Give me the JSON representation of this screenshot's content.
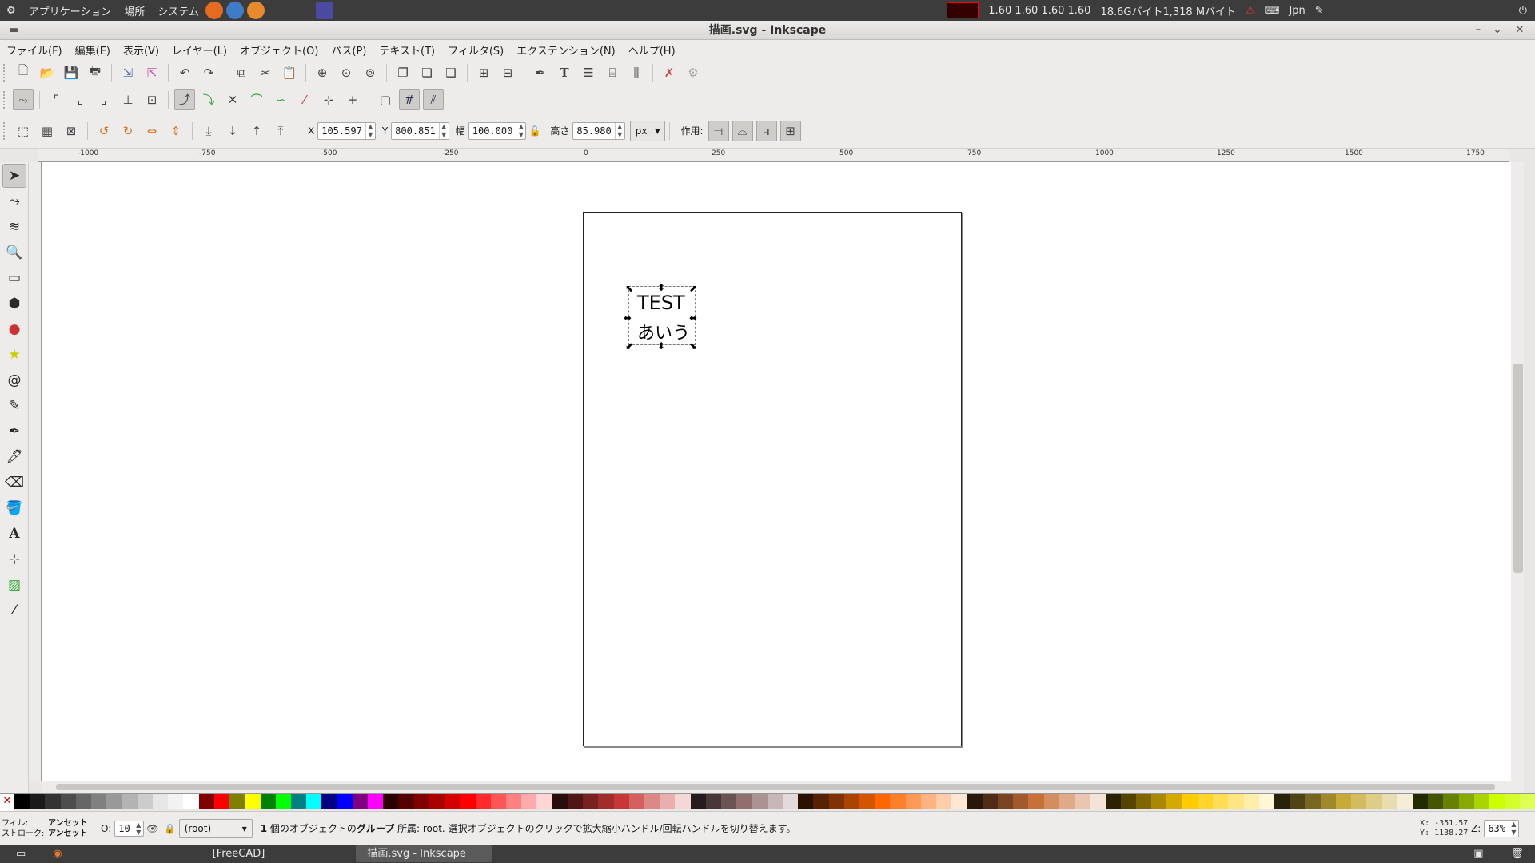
{
  "topbar": {
    "menus": [
      "アプリケーション",
      "場所",
      "システム"
    ],
    "cpu": "1.60 1.60  1.60  1.60",
    "memory": "18.6Gバイト1,318 Mバイト",
    "lang": "Jpn"
  },
  "window": {
    "title": "描画.svg - Inkscape"
  },
  "menubar": {
    "items": [
      "ファイル(F)",
      "編集(E)",
      "表示(V)",
      "レイヤー(L)",
      "オブジェクト(O)",
      "パス(P)",
      "テキスト(T)",
      "フィルタ(S)",
      "エクステンション(N)",
      "ヘルプ(H)"
    ]
  },
  "controls": {
    "x_label": "X",
    "x_value": "105.597",
    "y_label": "Y",
    "y_value": "800.851",
    "w_label": "幅",
    "w_value": "100.000",
    "h_label": "高さ",
    "h_value": "85.980",
    "unit": "px",
    "affect_label": "作用:"
  },
  "ruler": {
    "labels": [
      "-1000",
      "-750",
      "-500",
      "-250",
      "0",
      "250",
      "500",
      "750",
      "1000",
      "1250",
      "1500",
      "1750"
    ]
  },
  "canvas": {
    "text_line1": "TEST",
    "text_line2": "あいう"
  },
  "status": {
    "fill_label": "フィル:",
    "stroke_label": "ストローク:",
    "fill_value": "アンセット",
    "stroke_value": "アンセット",
    "opacity_label": "O:",
    "opacity_value": "10",
    "layer": "(root)",
    "message_bold1": "1",
    "message_part1": " 個のオブジェクトの",
    "message_bold2": "グループ",
    "message_part2": " 所属: root. 選択オブジェクトのクリックで拡大縮小ハンドル/回転ハンドルを切り替えます。",
    "cursor_x": "X: -351.57",
    "cursor_y": "Y: 1138.27",
    "zoom_label": "Z:",
    "zoom_value": "63%"
  },
  "taskbar": {
    "items": [
      "[FreeCAD]",
      "描画.svg - Inkscape"
    ]
  },
  "palette": [
    "#000000",
    "#1a1a1a",
    "#333333",
    "#4d4d4d",
    "#666666",
    "#808080",
    "#999999",
    "#b3b3b3",
    "#cccccc",
    "#e6e6e6",
    "#f2f2f2",
    "#ffffff",
    "#800000",
    "#ff0000",
    "#808000",
    "#ffff00",
    "#008000",
    "#00ff00",
    "#008080",
    "#00ffff",
    "#000080",
    "#0000ff",
    "#800080",
    "#ff00ff",
    "#2b0000",
    "#550000",
    "#800000",
    "#aa0000",
    "#d40000",
    "#ff0000",
    "#ff2a2a",
    "#ff5555",
    "#ff8080",
    "#ffaaaa",
    "#ffd5d5",
    "#280b0b",
    "#501616",
    "#782121",
    "#a02c2c",
    "#c83737",
    "#d35f5f",
    "#de8787",
    "#e9afaf",
    "#f4d7d7",
    "#241c1c",
    "#483737",
    "#6c5353",
    "#916f6f",
    "#ac9393",
    "#c8b7b7",
    "#e3dbdb",
    "#2b1100",
    "#552200",
    "#803300",
    "#aa4400",
    "#d45500",
    "#ff6600",
    "#ff7f2a",
    "#ff9955",
    "#ffb380",
    "#ffccaa",
    "#ffe6d5",
    "#28170b",
    "#502d16",
    "#784421",
    "#a05a2c",
    "#c87137",
    "#d38d5f",
    "#deaa87",
    "#e9c6af",
    "#f4e3d7",
    "#2b2200",
    "#554400",
    "#806600",
    "#aa8800",
    "#d4aa00",
    "#ffcc00",
    "#ffd42a",
    "#ffdd55",
    "#ffe680",
    "#ffeeaa",
    "#fff6d5",
    "#28220b",
    "#504416",
    "#786721",
    "#a0892c",
    "#c8ab37",
    "#d3bc5f",
    "#decd87",
    "#e9ddaf",
    "#f4eed7",
    "#222b00",
    "#445500",
    "#668000",
    "#88aa00",
    "#aad400",
    "#ccff00",
    "#d4ff2a",
    "#ddff55"
  ]
}
